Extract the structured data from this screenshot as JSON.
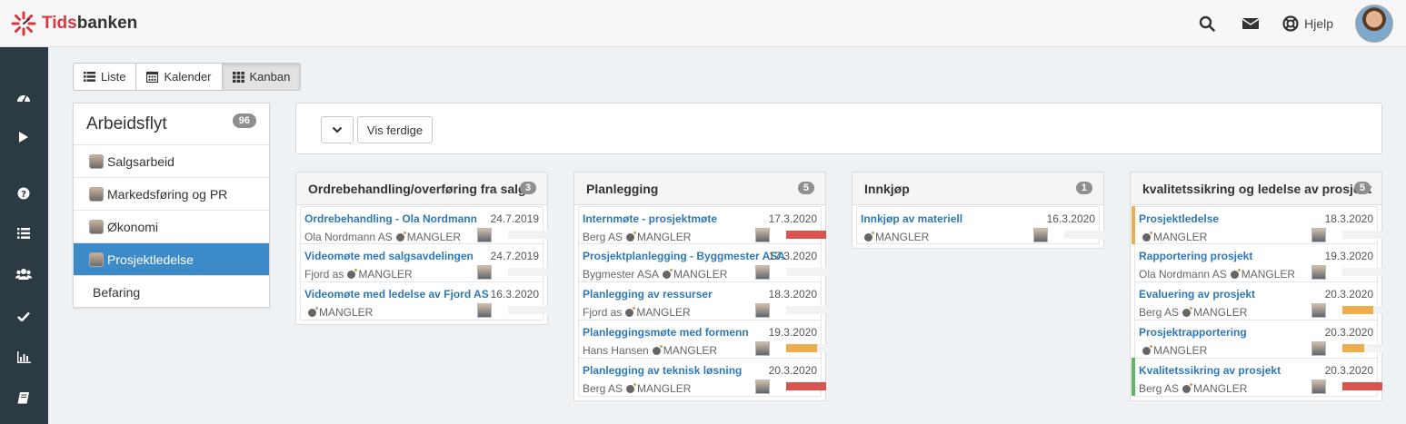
{
  "app": {
    "logo_prefix": "Tids",
    "logo_suffix": "banken"
  },
  "header": {
    "help_label": "Hjelp"
  },
  "colors": {
    "sidebar": "#2c3a43",
    "active": "#3d8ac9",
    "link": "#2f78b7",
    "red": "#d9534f",
    "orange": "#f0ad4e",
    "green": "#5cb85c"
  },
  "sidebar": {
    "items": [
      {
        "icon": "dashboard-icon"
      },
      {
        "icon": "play-icon"
      },
      {
        "icon": "help-icon"
      },
      {
        "icon": "list-icon"
      },
      {
        "icon": "users-icon"
      },
      {
        "icon": "check-icon"
      },
      {
        "icon": "chart-icon"
      },
      {
        "icon": "book-icon"
      }
    ]
  },
  "views": {
    "list": "Liste",
    "calendar": "Kalender",
    "kanban": "Kanban",
    "active": "Kanban"
  },
  "workflow": {
    "title": "Arbeidsflyt",
    "count": "96",
    "items": [
      {
        "label": "Salgsarbeid",
        "avatar": true,
        "active": false
      },
      {
        "label": "Markedsføring og PR",
        "avatar": true,
        "active": false
      },
      {
        "label": "Økonomi",
        "avatar": true,
        "active": false
      },
      {
        "label": "Prosjektledelse",
        "avatar": true,
        "active": true
      },
      {
        "label": "Befaring",
        "avatar": false,
        "active": false
      }
    ]
  },
  "filter": {
    "show_done_label": "Vis ferdige"
  },
  "columns": [
    {
      "title": "Ordrebehandling/overføring fra salg",
      "count": "3",
      "cards": [
        {
          "title": "Ordrebehandling - Ola Nordmann",
          "date": "24.7.2019",
          "customer": "Ola Nordmann AS",
          "status": "MANGLER",
          "progress": 0,
          "bar_color": "",
          "band": ""
        },
        {
          "title": "Videomøte med salgsavdelingen",
          "date": "24.7.2019",
          "customer": "Fjord as",
          "status": "MANGLER",
          "progress": 0,
          "bar_color": "",
          "band": ""
        },
        {
          "title": "Videomøte med ledelse av Fjord AS",
          "date": "16.3.2020",
          "customer": "",
          "status": "MANGLER",
          "progress": 0,
          "bar_color": "",
          "band": ""
        }
      ]
    },
    {
      "title": "Planlegging",
      "count": "5",
      "cards": [
        {
          "title": "Internmøte - prosjektmøte",
          "date": "17.3.2020",
          "customer": "Berg AS",
          "status": "MANGLER",
          "progress": 1.0,
          "bar_color": "#d9534f",
          "band": ""
        },
        {
          "title": "Prosjektplanlegging - Byggmester ASA",
          "date": "17.3.2020",
          "customer": "Bygmester ASA",
          "status": "MANGLER",
          "progress": 0,
          "bar_color": "",
          "band": ""
        },
        {
          "title": "Planlegging av ressurser",
          "date": "18.3.2020",
          "customer": "Fjord as",
          "status": "MANGLER",
          "progress": 0,
          "bar_color": "",
          "band": ""
        },
        {
          "title": "Planleggingsmøte med formenn",
          "date": "19.3.2020",
          "customer": "Hans Hansen",
          "status": "MANGLER",
          "progress": 0.78,
          "bar_color": "#f0ad4e",
          "band": ""
        },
        {
          "title": "Planlegging av teknisk løsning",
          "date": "20.3.2020",
          "customer": "Berg AS",
          "status": "MANGLER",
          "progress": 1.0,
          "bar_color": "#d9534f",
          "band": ""
        }
      ]
    },
    {
      "title": "Innkjøp",
      "count": "1",
      "cards": [
        {
          "title": "Innkjøp av materiell",
          "date": "16.3.2020",
          "customer": "",
          "status": "MANGLER",
          "progress": 0,
          "bar_color": "",
          "band": ""
        }
      ]
    },
    {
      "title": "kvalitetssikring og ledelse av prosjekt",
      "count": "5",
      "cards": [
        {
          "title": "Prosjektledelse",
          "date": "18.3.2020",
          "customer": "",
          "status": "MANGLER",
          "progress": 0,
          "bar_color": "",
          "band": "#f0ad4e"
        },
        {
          "title": "Rapportering prosjekt",
          "date": "19.3.2020",
          "customer": "Ola Nordmann AS",
          "status": "MANGLER",
          "progress": 0,
          "bar_color": "",
          "band": ""
        },
        {
          "title": "Evaluering av prosjekt",
          "date": "20.3.2020",
          "customer": "Berg AS",
          "status": "MANGLER",
          "progress": 0.78,
          "bar_color": "#f0ad4e",
          "band": ""
        },
        {
          "title": "Prosjektrapportering",
          "date": "20.3.2020",
          "customer": "",
          "status": "MANGLER",
          "progress": 0.55,
          "bar_color": "#f0ad4e",
          "band": ""
        },
        {
          "title": "Kvalitetssikring av prosjekt",
          "date": "20.3.2020",
          "customer": "Berg AS",
          "status": "MANGLER",
          "progress": 1.0,
          "bar_color": "#d9534f",
          "band": "#5cb85c"
        }
      ]
    }
  ]
}
